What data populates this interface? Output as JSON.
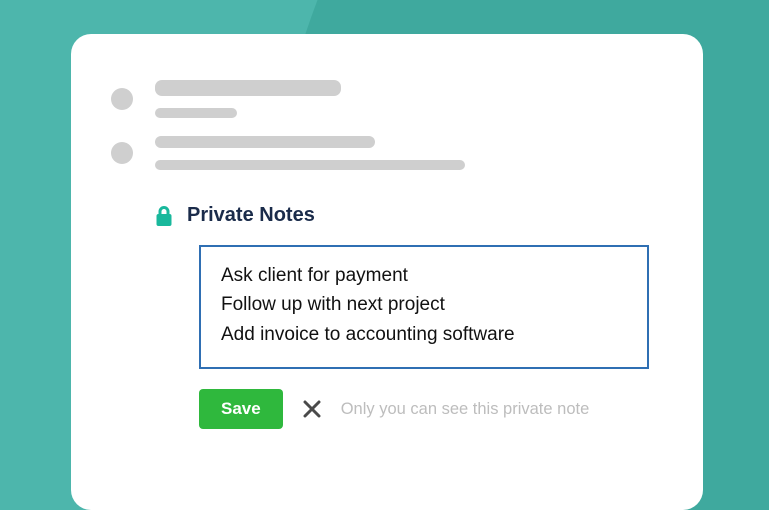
{
  "colors": {
    "bg_outer": "#4db6ac",
    "bg_inner": "#3fa99e",
    "card": "#ffffff",
    "skeleton": "#cfcfcf",
    "title": "#1a2b4a",
    "border": "#2f6fb3",
    "save_bg": "#2fb83d",
    "hint": "#bdbdbd",
    "lock": "#19b89c"
  },
  "private_notes": {
    "title": "Private Notes",
    "icon": "lock-icon",
    "content": "Ask client for payment\nFollow up with next project\nAdd invoice to accounting software"
  },
  "actions": {
    "save_label": "Save",
    "cancel_icon": "close-icon",
    "hint": "Only you can see this private note"
  }
}
